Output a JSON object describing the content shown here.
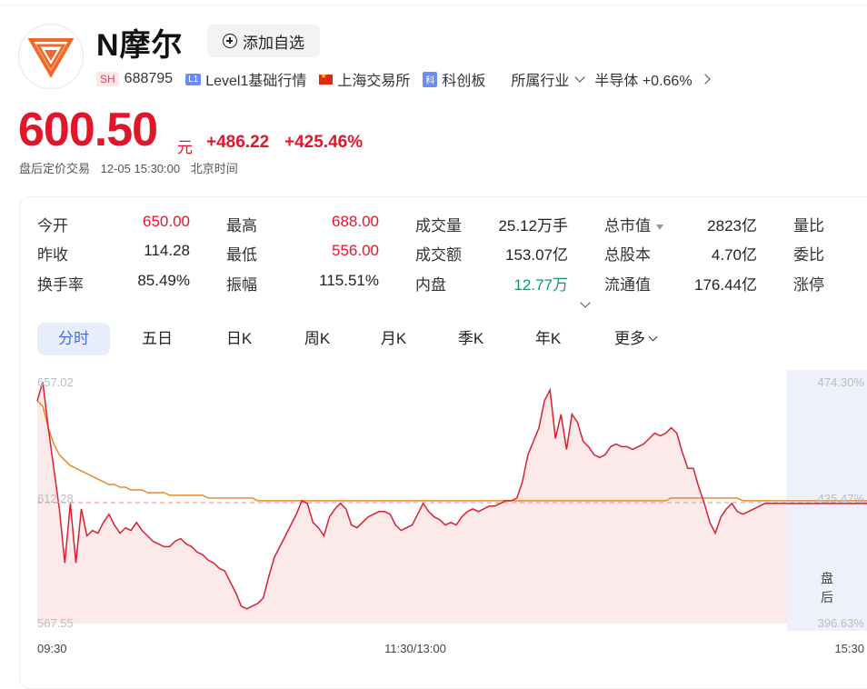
{
  "stock": {
    "name": "N摩尔",
    "exchange_badge": "SH",
    "code": "688795",
    "level": "Level1基础行情",
    "exchange": "上海交易所",
    "board": "科创板",
    "industry_label": "所属行业",
    "industry": "半导体 +0.66%",
    "watch_label": "添加自选"
  },
  "quote": {
    "price": "600.50",
    "unit": "元",
    "change": "+486.22",
    "change_pct": "+425.46%",
    "session": "盘后定价交易",
    "time": "12-05 15:30:00",
    "tz": "北京时间"
  },
  "stats": [
    {
      "label": "今开",
      "value": "650.00"
    },
    {
      "label": "最高",
      "value": "688.00"
    },
    {
      "label": "成交量",
      "value": "25.12万手"
    },
    {
      "label": "总市值",
      "value": "2823亿"
    },
    {
      "label": "量比",
      "value": ""
    },
    {
      "label": "昨收",
      "value": "114.28"
    },
    {
      "label": "最低",
      "value": "556.00"
    },
    {
      "label": "成交额",
      "value": "153.07亿"
    },
    {
      "label": "总股本",
      "value": "4.70亿"
    },
    {
      "label": "委比",
      "value": ""
    },
    {
      "label": "换手率",
      "value": "85.49%"
    },
    {
      "label": "振幅",
      "value": "115.51%"
    },
    {
      "label": "内盘",
      "value": "12.77万"
    },
    {
      "label": "流通值",
      "value": "176.44亿"
    },
    {
      "label": "涨停",
      "value": ""
    }
  ],
  "tabs": [
    "分时",
    "五日",
    "日K",
    "周K",
    "月K",
    "季K",
    "年K",
    "更多"
  ],
  "chart": {
    "y_left": [
      "657.02",
      "612.28",
      "567.55"
    ],
    "y_right": [
      "474.30%",
      "435.47%",
      "396.63%"
    ],
    "x_labels": [
      "09:30",
      "11:30/13:00",
      "15:30"
    ],
    "after_hours_label": "盘后",
    "colors": {
      "price": "#d8202e",
      "avg": "#e98a2a",
      "fill": "#fbe3e4",
      "ref": "#f08a8a",
      "after": "#eef0fc"
    }
  },
  "chart_data": {
    "type": "line",
    "ylim": [
      567.55,
      657.02
    ],
    "reference": 612.28,
    "series": [
      {
        "values": [
          650,
          657,
          640,
          625,
          610,
          590,
          612,
          590,
          610,
          600,
          602,
          601,
          605,
          608,
          604,
          601,
          603,
          602,
          605,
          602,
          600,
          598,
          597,
          596,
          596,
          598,
          599,
          597,
          596,
          594,
          593,
          591,
          590,
          588,
          587,
          583,
          579,
          574,
          573,
          574,
          575,
          577,
          585,
          592,
          596,
          600,
          604,
          608,
          613,
          612,
          605,
          603,
          600,
          607,
          610,
          612,
          610,
          604,
          603,
          605,
          607,
          608,
          609,
          609,
          608,
          604,
          602,
          603,
          604,
          608,
          612,
          609,
          607,
          606,
          604,
          605,
          604,
          607,
          609,
          610,
          609,
          610,
          611,
          611,
          612,
          613,
          613,
          614,
          620,
          630,
          635,
          640,
          650,
          654,
          636,
          645,
          632,
          645,
          642,
          635,
          633,
          630,
          629,
          630,
          633,
          634,
          633,
          633,
          632,
          633,
          634,
          636,
          638,
          637,
          638,
          640,
          638,
          631,
          625,
          625,
          618,
          612,
          605,
          601,
          607,
          610,
          612,
          609,
          608,
          609,
          610,
          611,
          612,
          612,
          612,
          612,
          612
        ]
      },
      {
        "values": [
          650,
          648,
          640,
          634,
          630,
          628,
          626,
          625,
          624,
          623,
          622,
          621,
          620,
          619,
          619,
          618,
          618,
          617,
          617,
          617,
          616,
          616,
          616,
          616,
          615,
          615,
          615,
          615,
          615,
          615,
          615,
          614,
          614,
          614,
          614,
          614,
          614,
          614,
          614,
          614,
          613,
          613,
          613,
          613,
          613,
          613,
          613,
          613,
          613,
          613,
          613,
          613,
          613,
          613,
          613,
          613,
          613,
          613,
          613,
          613,
          613,
          613,
          613,
          613,
          613,
          613,
          613,
          613,
          613,
          613,
          613,
          613,
          613,
          613,
          613,
          613,
          613,
          613,
          613,
          613,
          613,
          613,
          613,
          613,
          613,
          613,
          613,
          613,
          613,
          613,
          613,
          613,
          613,
          613,
          613,
          613,
          613,
          613,
          613,
          613,
          613,
          613,
          613,
          613,
          613,
          613,
          613,
          613,
          613,
          613,
          613,
          613,
          613,
          613,
          613,
          614,
          614,
          614,
          614,
          614,
          614,
          614,
          614,
          614,
          614,
          614,
          614,
          614,
          613,
          613,
          613,
          613,
          613,
          613,
          613,
          613,
          613
        ]
      }
    ]
  }
}
